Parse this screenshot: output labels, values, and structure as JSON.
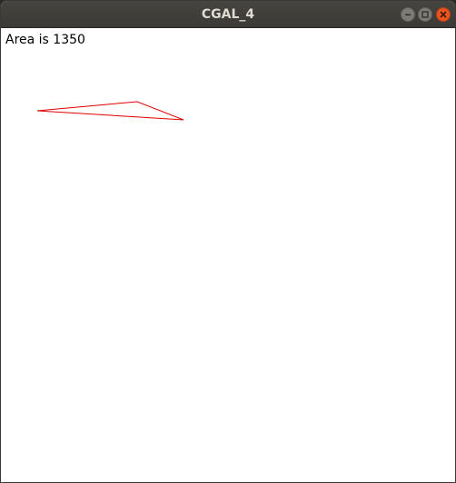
{
  "window": {
    "title": "CGAL_4"
  },
  "content": {
    "area_text": "Area is 1350"
  },
  "shape": {
    "type": "triangle",
    "stroke_color": "#e00000"
  },
  "icons": {
    "minimize": "minimize-icon",
    "maximize": "maximize-icon",
    "close": "close-icon"
  }
}
